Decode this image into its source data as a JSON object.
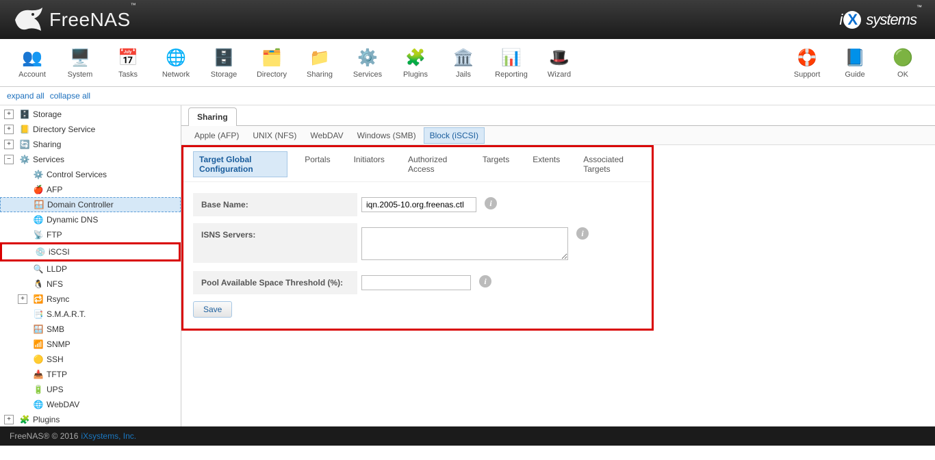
{
  "header": {
    "product": "FreeNAS",
    "tm": "™",
    "company": "iXsystems",
    "company_tm": "™"
  },
  "toolbar": {
    "left": [
      {
        "label": "Account",
        "icon": "👥"
      },
      {
        "label": "System",
        "icon": "🖥️"
      },
      {
        "label": "Tasks",
        "icon": "📅"
      },
      {
        "label": "Network",
        "icon": "🌐"
      },
      {
        "label": "Storage",
        "icon": "🗄️"
      },
      {
        "label": "Directory",
        "icon": "🗂️"
      },
      {
        "label": "Sharing",
        "icon": "📁"
      },
      {
        "label": "Services",
        "icon": "⚙️"
      },
      {
        "label": "Plugins",
        "icon": "🧩"
      },
      {
        "label": "Jails",
        "icon": "🏛️"
      },
      {
        "label": "Reporting",
        "icon": "📊"
      },
      {
        "label": "Wizard",
        "icon": "🎩"
      }
    ],
    "right": [
      {
        "label": "Support",
        "icon": "🛟"
      },
      {
        "label": "Guide",
        "icon": "📘"
      },
      {
        "label": "OK",
        "icon": "🟢"
      }
    ]
  },
  "tree_controls": {
    "expand": "expand all",
    "collapse": "collapse all"
  },
  "tree": [
    {
      "level": 1,
      "icon": "🗄️",
      "label": "Storage",
      "expander": "+"
    },
    {
      "level": 1,
      "icon": "📒",
      "label": "Directory Service",
      "expander": "+"
    },
    {
      "level": 1,
      "icon": "🔄",
      "label": "Sharing",
      "expander": "+"
    },
    {
      "level": 1,
      "icon": "⚙️",
      "label": "Services",
      "expander": "−"
    },
    {
      "level": 2,
      "icon": "⚙️",
      "label": "Control Services",
      "expander": ""
    },
    {
      "level": 2,
      "icon": "🍎",
      "label": "AFP",
      "expander": ""
    },
    {
      "level": 2,
      "icon": "🪟",
      "label": "Domain Controller",
      "expander": "",
      "selected": true
    },
    {
      "level": 2,
      "icon": "🌐",
      "label": "Dynamic DNS",
      "expander": ""
    },
    {
      "level": 2,
      "icon": "📡",
      "label": "FTP",
      "expander": ""
    },
    {
      "level": 2,
      "icon": "💿",
      "label": "iSCSI",
      "expander": "",
      "highlighted": true
    },
    {
      "level": 2,
      "icon": "🔍",
      "label": "LLDP",
      "expander": ""
    },
    {
      "level": 2,
      "icon": "🐧",
      "label": "NFS",
      "expander": ""
    },
    {
      "level": 2,
      "icon": "🔁",
      "label": "Rsync",
      "expander": "+"
    },
    {
      "level": 2,
      "icon": "📑",
      "label": "S.M.A.R.T.",
      "expander": ""
    },
    {
      "level": 2,
      "icon": "🪟",
      "label": "SMB",
      "expander": ""
    },
    {
      "level": 2,
      "icon": "📶",
      "label": "SNMP",
      "expander": ""
    },
    {
      "level": 2,
      "icon": "🟡",
      "label": "SSH",
      "expander": ""
    },
    {
      "level": 2,
      "icon": "📥",
      "label": "TFTP",
      "expander": ""
    },
    {
      "level": 2,
      "icon": "🔋",
      "label": "UPS",
      "expander": ""
    },
    {
      "level": 2,
      "icon": "🌐",
      "label": "WebDAV",
      "expander": ""
    },
    {
      "level": 1,
      "icon": "🧩",
      "label": "Plugins",
      "expander": "+"
    }
  ],
  "tabs": {
    "top": "Sharing",
    "sub": [
      {
        "label": "Apple (AFP)"
      },
      {
        "label": "UNIX (NFS)"
      },
      {
        "label": "WebDAV"
      },
      {
        "label": "Windows (SMB)"
      },
      {
        "label": "Block (iSCSI)",
        "active": true
      }
    ],
    "inner": [
      {
        "label": "Target Global Configuration",
        "active": true
      },
      {
        "label": "Portals"
      },
      {
        "label": "Initiators"
      },
      {
        "label": "Authorized Access"
      },
      {
        "label": "Targets"
      },
      {
        "label": "Extents"
      },
      {
        "label": "Associated Targets"
      }
    ]
  },
  "form": {
    "base_name_label": "Base Name:",
    "base_name_value": "iqn.2005-10.org.freenas.ctl",
    "isns_label": "ISNS Servers:",
    "isns_value": "",
    "pool_label": "Pool Available Space Threshold (%):",
    "pool_value": "",
    "save": "Save"
  },
  "footer": {
    "text": "FreeNAS® © 2016",
    "link": "iXsystems, Inc."
  }
}
